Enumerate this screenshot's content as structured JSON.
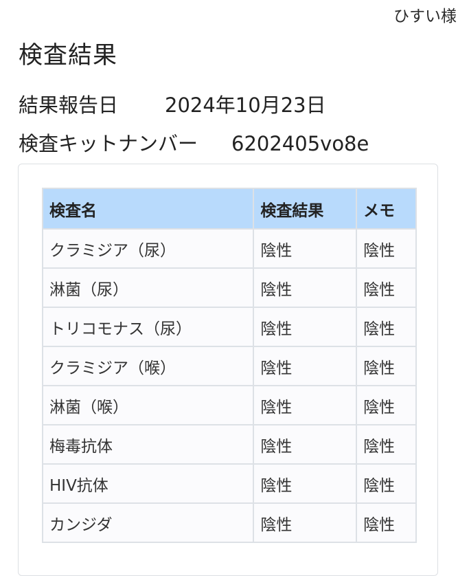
{
  "header": {
    "user_name": "ひすい様"
  },
  "page": {
    "title": "検査結果",
    "report_date_label": "結果報告日",
    "report_date_value": "2024年10月23日",
    "kit_number_label": "検査キットナンバー",
    "kit_number_value": "6202405vo8e"
  },
  "table": {
    "columns": [
      "検査名",
      "検査結果",
      "メモ"
    ],
    "rows": [
      {
        "name": "クラミジア（尿）",
        "result": "陰性",
        "memo": "陰性"
      },
      {
        "name": "淋菌（尿）",
        "result": "陰性",
        "memo": "陰性"
      },
      {
        "name": "トリコモナス（尿）",
        "result": "陰性",
        "memo": "陰性"
      },
      {
        "name": "クラミジア（喉）",
        "result": "陰性",
        "memo": "陰性"
      },
      {
        "name": "淋菌（喉）",
        "result": "陰性",
        "memo": "陰性"
      },
      {
        "name": "梅毒抗体",
        "result": "陰性",
        "memo": "陰性"
      },
      {
        "name": "HIV抗体",
        "result": "陰性",
        "memo": "陰性"
      },
      {
        "name": "カンジダ",
        "result": "陰性",
        "memo": "陰性"
      }
    ]
  },
  "colors": {
    "header_bg": "#b8dafc",
    "cell_bg": "#fbfbfd",
    "grid_line": "#dde1e6"
  }
}
